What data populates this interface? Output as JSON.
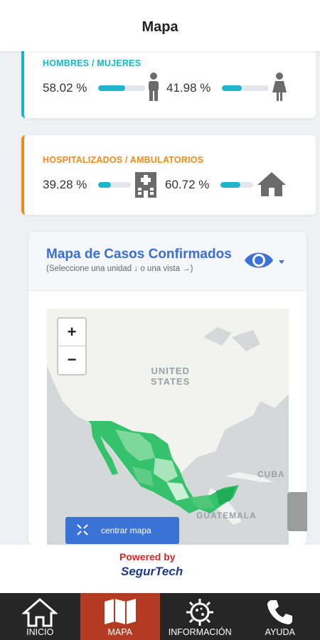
{
  "header": {
    "title": "Mapa"
  },
  "gender_card": {
    "title": "HOMBRES / MUJERES",
    "men": {
      "value": "58.02 %",
      "fraction": 0.5802
    },
    "women": {
      "value": "41.98 %",
      "fraction": 0.4198
    },
    "accent": "#17b6c9"
  },
  "hosp_card": {
    "title": "HOSPITALIZADOS / AMBULATORIOS",
    "hospitalized": {
      "value": "39.28 %",
      "fraction": 0.3928
    },
    "ambulatory": {
      "value": "60.72 %",
      "fraction": 0.6072
    },
    "accent": "#f08a1d"
  },
  "map_card": {
    "title": "Mapa de Casos Confirmados",
    "subtitle": "(Seleccione una unidad ↓ o una vista →)",
    "zoom_in": "+",
    "zoom_out": "−",
    "labels": {
      "us_line1": "UNITED",
      "us_line2": "STATES",
      "cuba": "CUBA",
      "guatemala": "GUATEMALA"
    },
    "center_button": "centrar mapa"
  },
  "footer": {
    "powered_by": "Powered by",
    "brand": "SegurTech"
  },
  "nav": {
    "items": [
      {
        "label": "INICIO",
        "icon": "home-icon",
        "active": false
      },
      {
        "label": "MAPA",
        "icon": "map-icon",
        "active": true
      },
      {
        "label": "INFORMACIÓN",
        "icon": "virus-icon",
        "active": false
      },
      {
        "label": "AYUDA",
        "icon": "phone-icon",
        "active": false
      }
    ]
  },
  "colors": {
    "brand_blue": "#3b6fd3",
    "nav_bg": "#262626",
    "nav_active": "#b43a22",
    "bar_fill": "#1fb6c9"
  }
}
